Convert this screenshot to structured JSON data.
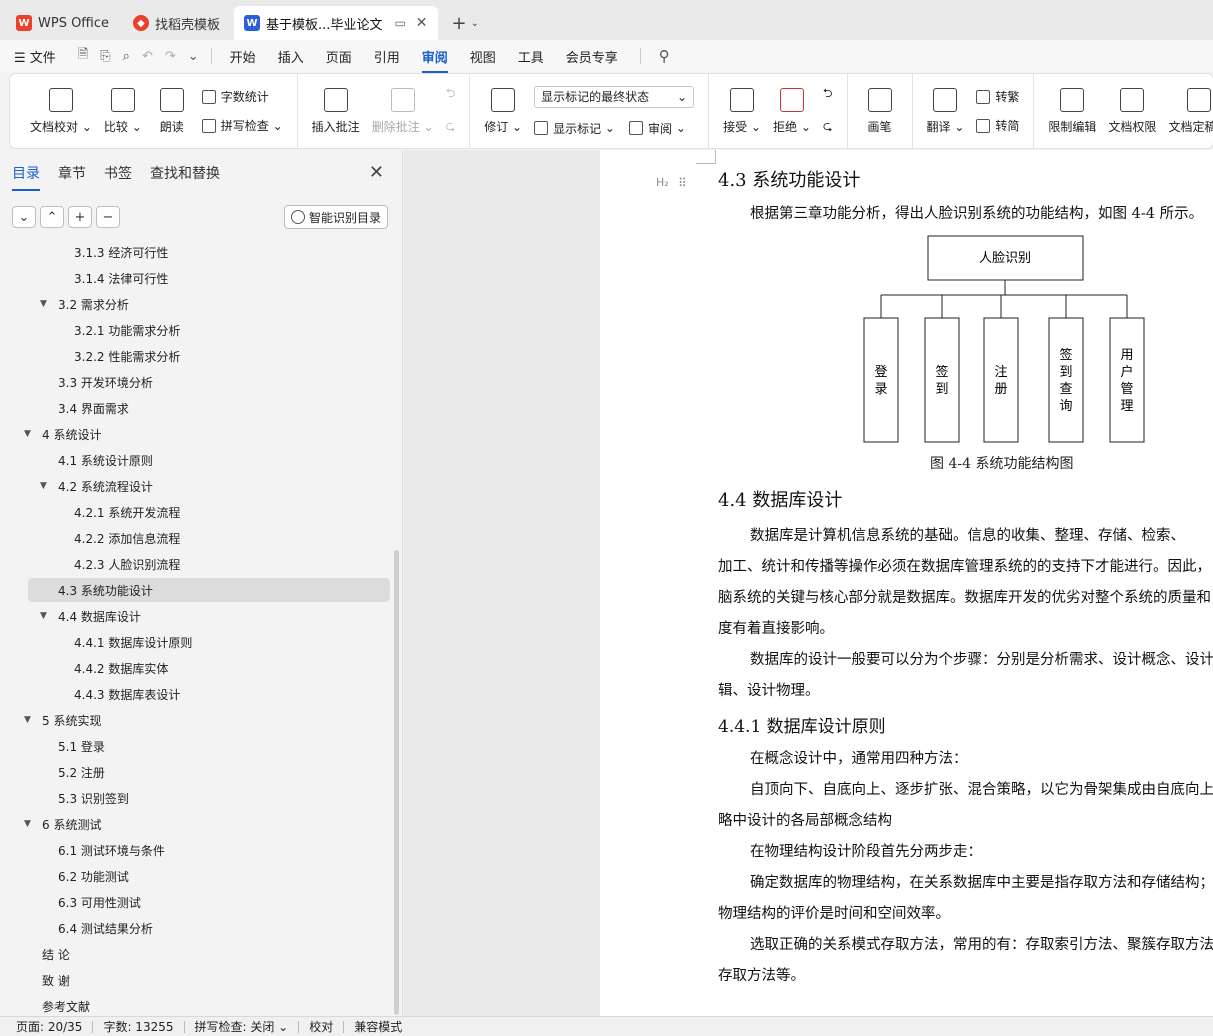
{
  "tabs": [
    {
      "label": "WPS Office",
      "active": false
    },
    {
      "label": "找稻壳模板",
      "active": false
    },
    {
      "label": "基于模板...毕业论文",
      "active": true
    }
  ],
  "menu": {
    "file": "文件",
    "items": [
      "开始",
      "插入",
      "页面",
      "引用",
      "审阅",
      "视图",
      "工具",
      "会员专享"
    ],
    "active": "审阅"
  },
  "ribbon": {
    "doc_check": "文档校对",
    "compare": "比较",
    "read_aloud": "朗读",
    "word_count": "字数统计",
    "spell_check": "拼写检查",
    "insert_comment": "插入批注",
    "delete_comment": "删除批注",
    "track_changes": "修订",
    "markup_mode": "显示标记的最终状态",
    "show_markup": "显示标记",
    "review": "审阅",
    "accept": "接受",
    "reject": "拒绝",
    "pen": "画笔",
    "translate": "翻译",
    "to_traditional": "转繁",
    "to_simplified": "转简",
    "restrict_edit": "限制编辑",
    "doc_permission": "文档权限",
    "finalize": "文档定稿"
  },
  "sidebar": {
    "tabs": [
      "目录",
      "章节",
      "书签",
      "查找和替换"
    ],
    "active_tab": "目录",
    "smart_toc": "智能识别目录",
    "toc": [
      {
        "label": "3.1.3  经济可行性",
        "level": 3,
        "arrow": ""
      },
      {
        "label": "3.1.4  法律可行性",
        "level": 3,
        "arrow": ""
      },
      {
        "label": "3.2 需求分析",
        "level": 2,
        "arrow": "▼"
      },
      {
        "label": "3.2.1  功能需求分析",
        "level": 3,
        "arrow": ""
      },
      {
        "label": "3.2.2  性能需求分析",
        "level": 3,
        "arrow": ""
      },
      {
        "label": "3.3 开发环境分析",
        "level": 2,
        "arrow": ""
      },
      {
        "label": "3.4 界面需求",
        "level": 2,
        "arrow": ""
      },
      {
        "label": "4  系统设计",
        "level": 1,
        "arrow": "▼"
      },
      {
        "label": "4.1 系统设计原则",
        "level": 2,
        "arrow": ""
      },
      {
        "label": "4.2 系统流程设计",
        "level": 2,
        "arrow": "▼"
      },
      {
        "label": "4.2.1 系统开发流程",
        "level": 3,
        "arrow": ""
      },
      {
        "label": "4.2.2  添加信息流程",
        "level": 3,
        "arrow": ""
      },
      {
        "label": "4.2.3  人脸识别流程",
        "level": 3,
        "arrow": ""
      },
      {
        "label": "4.3  系统功能设计",
        "level": 2,
        "arrow": ""
      },
      {
        "label": "4.4  数据库设计",
        "level": 2,
        "arrow": "▼"
      },
      {
        "label": "4.4.1  数据库设计原则",
        "level": 3,
        "arrow": ""
      },
      {
        "label": "4.4.2  数据库实体",
        "level": 3,
        "arrow": ""
      },
      {
        "label": "4.4.3  数据库表设计",
        "level": 3,
        "arrow": ""
      },
      {
        "label": "5 系统实现",
        "level": 1,
        "arrow": "▼"
      },
      {
        "label": "5.1  登录",
        "level": 2,
        "arrow": ""
      },
      {
        "label": "5.2  注册",
        "level": 2,
        "arrow": ""
      },
      {
        "label": "5.3  识别签到",
        "level": 2,
        "arrow": ""
      },
      {
        "label": "6 系统测试",
        "level": 1,
        "arrow": "▼"
      },
      {
        "label": "6.1 测试环境与条件",
        "level": 2,
        "arrow": ""
      },
      {
        "label": "6.2 功能测试",
        "level": 2,
        "arrow": ""
      },
      {
        "label": "6.3 可用性测试",
        "level": 2,
        "arrow": ""
      },
      {
        "label": "6.4 测试结果分析",
        "level": 2,
        "arrow": ""
      },
      {
        "label": "结      论",
        "level": 1,
        "arrow": ""
      },
      {
        "label": "致      谢",
        "level": 1,
        "arrow": ""
      },
      {
        "label": "参考文献",
        "level": 1,
        "arrow": ""
      }
    ],
    "selected": "4.3  系统功能设计"
  },
  "document": {
    "h2_marker": "H₂",
    "section_43": "4.3  系统功能设计",
    "para_43": "根据第三章功能分析，得出人脸识别系统的功能结构，如图 4-4 所示。",
    "figure": {
      "root": "人脸识别",
      "children": [
        "登录",
        "签到",
        "注册",
        "签到查询",
        "用户管理"
      ],
      "caption": "图 4-4  系统功能结构图"
    },
    "section_44": "4.4  数据库设计",
    "p1_l1": "数据库是计算机信息系统的基础。信息的收集、整理、存储、检索、",
    "p1_l2": "加工、统计和传播等操作必须在数据库管理系统的的支持下才能进行。因此，",
    "p1_l3": "脑系统的关键与核心部分就是数据库。数据库开发的优劣对整个系统的质量和",
    "p1_l4": "度有着直接影响。",
    "p2_l1": "数据库的设计一般要可以分为个步骤：分别是分析需求、设计概念、设计逻",
    "p2_l2": "辑、设计物理。",
    "section_441": "4.4.1  数据库设计原则",
    "p3": "在概念设计中，通常用四种方法：",
    "p4_l1": "自顶向下、自底向上、逐步扩张、混合策略，以它为骨架集成由自底向上策",
    "p4_l2": "略中设计的各局部概念结构",
    "p5": "在物理结构设计阶段首先分两步走：",
    "p6_l1": "确定数据库的物理结构，在关系数据库中主要是指存取方法和存储结构；对",
    "p6_l2": "物理结构的评价是时间和空间效率。",
    "p7_l1": "选取正确的关系模式存取方法，常用的有：存取索引方法、聚簇存取方法、",
    "p7_l2": "存取方法等。"
  },
  "status": {
    "page": "页面: 20/35",
    "words": "字数: 13255",
    "spell": "拼写检查: 关闭",
    "proof": "校对",
    "compat": "兼容模式"
  },
  "colors": {
    "accent": "#1a5fd0",
    "wps_red": "#e8412c"
  }
}
